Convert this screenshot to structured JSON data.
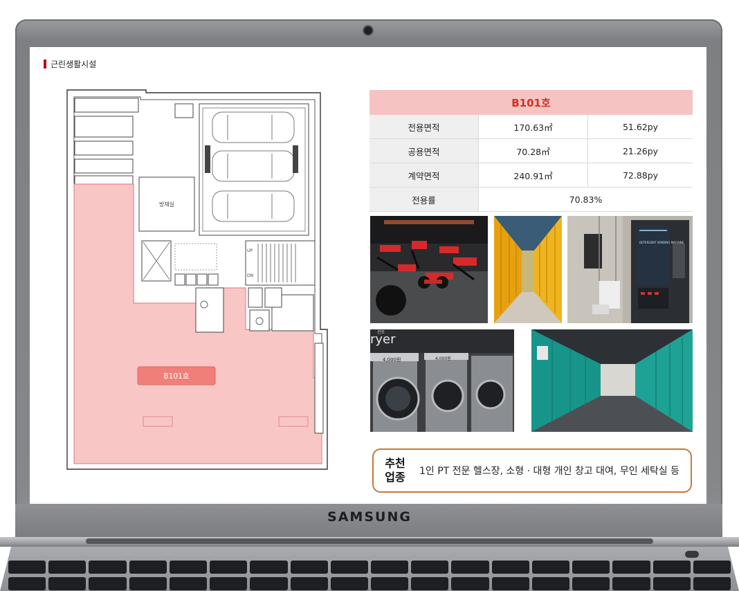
{
  "device": {
    "brand": "SAMSUNG"
  },
  "slide": {
    "section_title": "근린생활시설",
    "floor_plan": {
      "unit_label": "B101호",
      "room_label": "방재실",
      "up_label": "UP",
      "dn_label": "DN"
    },
    "unit_table": {
      "header": "B101호",
      "rows": [
        {
          "label": "전용면적",
          "m2": "170.63㎡",
          "py": "51.62py"
        },
        {
          "label": "공용면적",
          "m2": "70.28㎡",
          "py": "21.26py"
        },
        {
          "label": "계약면적",
          "m2": "240.91㎡",
          "py": "72.88py"
        }
      ],
      "ratio_label": "전용률",
      "ratio_value": "70.83%"
    },
    "photos": [
      {
        "name": "gym-photo"
      },
      {
        "name": "yellow-storage-corridor-photo"
      },
      {
        "name": "detergent-vending-photo",
        "text": "DETERGENT VENDING MACHINE"
      },
      {
        "name": "laundromat-photo",
        "text": "ryer",
        "sign": "건조",
        "price1": "4,000원",
        "price2": "4,000원"
      },
      {
        "name": "teal-storage-corridor-photo"
      }
    ],
    "recommendation": {
      "label_line1": "추천",
      "label_line2": "업종",
      "text": "1인 PT 전문 헬스장, 소형 · 대형 개인 창고 대여, 무인 세탁실 등"
    }
  },
  "colors": {
    "unit_fill": "#f9c6c6",
    "unit_badge": "#f17f79",
    "table_header": "#f6c3c3",
    "accent_text": "#d0301f",
    "reco_border": "#c37a3a"
  }
}
